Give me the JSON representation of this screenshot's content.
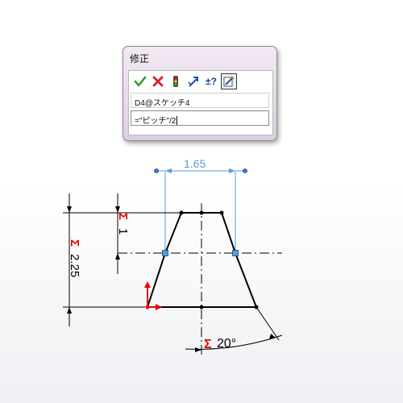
{
  "dialog": {
    "title": "修正",
    "icons": [
      "ok-check-icon",
      "cancel-x-icon",
      "rebuild-traffic-light-icon",
      "reverse-dimension-icon",
      "tolerance-icon",
      "mark-dimension-icon"
    ],
    "dimension_name": "D4@スケッチ4",
    "value_text": "=\"ピッチ\"/2"
  },
  "sketch": {
    "top_width_dim": "1.65",
    "upper_height_dim": "1",
    "total_height_dim": "2.25",
    "angle_dim": "20°",
    "equation_symbol": "Σ",
    "colors": {
      "dimension_blue": "#5b9bd5",
      "sketch_black": "#000000",
      "equation_red": "#e60000",
      "handle_blue": "#3a7fd4"
    }
  }
}
